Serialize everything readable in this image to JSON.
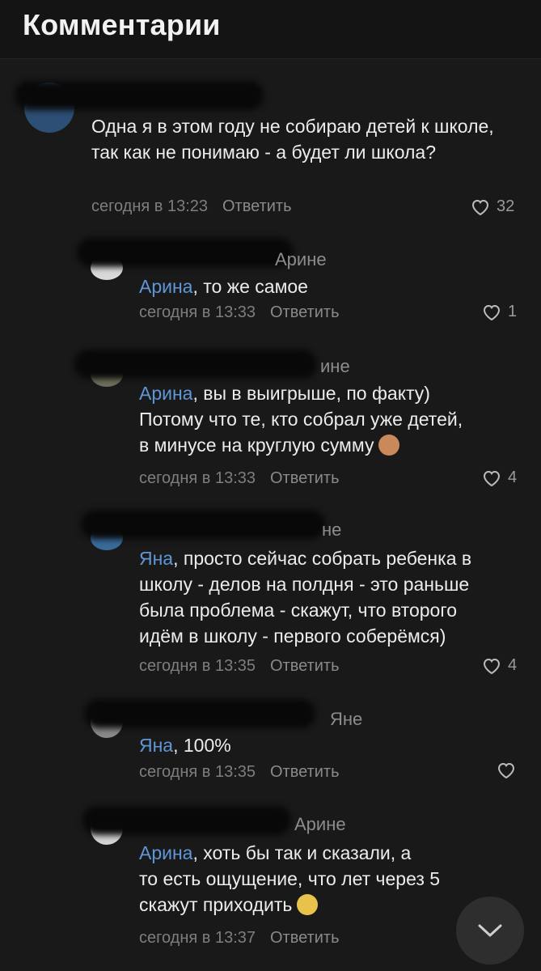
{
  "header": {
    "title": "Комментарии"
  },
  "comments": [
    {
      "text": "Одна я в этом году не собираю детей к школе, так как не понимаю - а будет ли школа?",
      "time": "сегодня в 13:23",
      "reply": "Ответить",
      "likes": "32"
    },
    {
      "reply_to_partial": "Арине",
      "mention": "Арина",
      "text": ", то же самое",
      "time": "сегодня в 13:33",
      "reply": "Ответить",
      "likes": "1"
    },
    {
      "reply_to_partial": "ине",
      "mention": "Арина",
      "line1": ", вы в выигрыше,  по факту)",
      "line2": "Потому что те, кто собрал уже детей,",
      "line3": "в минусе на круглую сумму",
      "time": "сегодня в 13:33",
      "reply": "Ответить",
      "likes": "4"
    },
    {
      "reply_to_partial": "не",
      "mention": "Яна",
      "line1": ", просто сейчас собрать ребенка в",
      "line2": "школу - делов на полдня - это раньше",
      "line3": "была проблема - скажут, что второго",
      "line4": "идём в школу - первого соберёмся)",
      "time": "сегодня в 13:35",
      "reply": "Ответить",
      "likes": "4"
    },
    {
      "reply_to_partial": "Яне",
      "mention": "Яна",
      "text": ", 100%",
      "time": "сегодня в 13:35",
      "reply": "Ответить"
    },
    {
      "reply_to_partial": "Арине",
      "mention": "Арина",
      "line1": ",  хоть бы так и сказали,  а",
      "line2": "то есть ощущение, что лет через 5",
      "line3": "скажут приходить",
      "time": "сегодня в 13:37",
      "reply": "Ответить"
    }
  ],
  "icons": {
    "like": "heart-icon",
    "scroll": "chevron-down-icon",
    "emoji1": "see-no-evil-monkey-emoji",
    "emoji2": "angry-face-emoji"
  },
  "colors": {
    "background": "#19191a",
    "mention": "#5f96d6",
    "meta": "#7e7e7e"
  }
}
